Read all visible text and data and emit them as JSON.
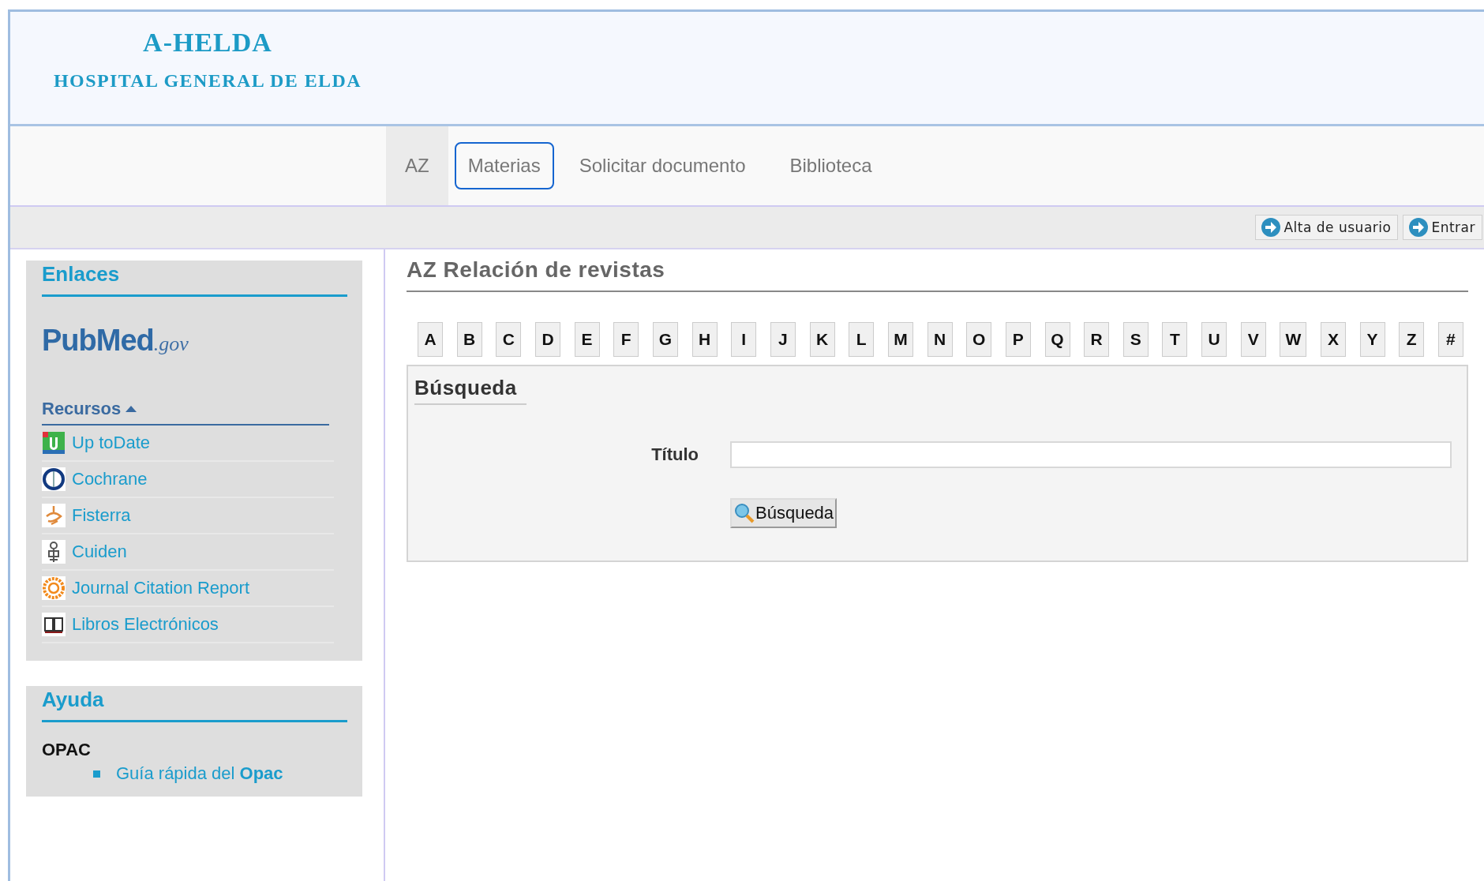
{
  "header": {
    "title": "A-HELDA",
    "subtitle": "HOSPITAL GENERAL DE ELDA"
  },
  "nav": [
    {
      "label": "AZ",
      "selected": true,
      "focused": false
    },
    {
      "label": "Materias",
      "selected": false,
      "focused": true
    },
    {
      "label": "Solicitar documento",
      "selected": false,
      "focused": false
    },
    {
      "label": "Biblioteca",
      "selected": false,
      "focused": false
    }
  ],
  "toolbar": [
    "Alta de usuario",
    "Entrar"
  ],
  "sidebar": {
    "links": {
      "title": "Enlaces",
      "logo": {
        "name": "PubMed",
        "suffix": ".gov"
      },
      "resources": {
        "title": "Recursos",
        "expanded": true,
        "items": [
          {
            "label": "Up toDate",
            "kind": "uptodate"
          },
          {
            "label": "Cochrane",
            "kind": "cochrane"
          },
          {
            "label": "Fisterra",
            "kind": "fisterra"
          },
          {
            "label": "Cuiden",
            "kind": "cuiden"
          },
          {
            "label": "Journal Citation Report",
            "kind": "jcr"
          },
          {
            "label": "Libros Electrónicos",
            "kind": "books"
          }
        ]
      }
    },
    "help": {
      "title": "Ayuda",
      "section": "OPAC",
      "links": [
        "Guía rápida del **Opac**"
      ]
    }
  },
  "main": {
    "title": "AZ Relación de revistas",
    "letters": [
      "A",
      "B",
      "C",
      "D",
      "E",
      "F",
      "G",
      "H",
      "I",
      "J",
      "K",
      "L",
      "M",
      "N",
      "O",
      "P",
      "Q",
      "R",
      "S",
      "T",
      "U",
      "V",
      "W",
      "X",
      "Y",
      "Z",
      "#"
    ],
    "search": {
      "title": "Búsqueda",
      "field_label": "Título",
      "button": "Búsqueda"
    }
  }
}
